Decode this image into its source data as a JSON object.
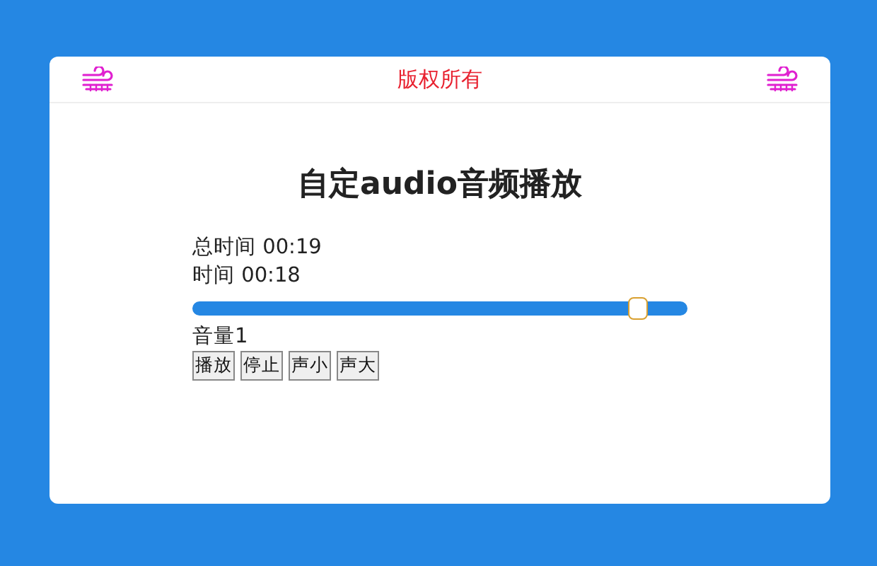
{
  "header": {
    "title": "版权所有"
  },
  "title": "自定audio音频播放",
  "total_time": "总时间 00:19",
  "current_time": "时间 00:18",
  "progress": {
    "level": 0.9
  },
  "volume": "音量1",
  "buttons": [
    "播放",
    "停止",
    "声小",
    "声大"
  ]
}
